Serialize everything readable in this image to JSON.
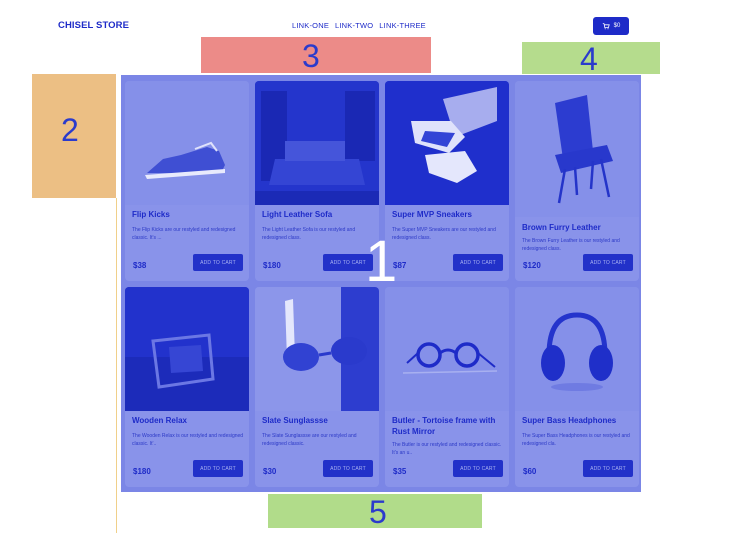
{
  "header": {
    "brand": "CHISEL STORE",
    "nav": [
      "LINK-ONE",
      "LINK-TWO",
      "LINK-THREE"
    ],
    "cart_count": "$0",
    "cart_icon": "cart-icon"
  },
  "annotations": {
    "one": "1",
    "two": "2",
    "three": "3",
    "four": "4",
    "five": "5"
  },
  "products": [
    {
      "title": "Flip Kicks",
      "desc": "The Flip Kicks are our restyled and redesigned classic. It's ...",
      "price": "$38",
      "button": "ADD TO CART"
    },
    {
      "title": "Light Leather Sofa",
      "desc": "The Light Leather Sofa is our restyled and redesigned class.",
      "price": "$180",
      "button": "ADD TO CART"
    },
    {
      "title": "Super MVP Sneakers",
      "desc": "The Super MVP Sneakers are our restyled and redesigned class.",
      "price": "$87",
      "button": "ADD TO CART"
    },
    {
      "title": "Brown Furry Leather",
      "desc": "The Brown Furry Leather is our restyled and redesigned class.",
      "price": "$120",
      "button": "ADD TO CART"
    },
    {
      "title": "Wooden Relax",
      "desc": "The Wooden Relax is our restyled and redesigned classic. It'..",
      "price": "$180",
      "button": "ADD TO CART"
    },
    {
      "title": "Slate Sunglassse",
      "desc": "The Slate Sunglassse are our restyled and redesigned classic.",
      "price": "$30",
      "button": "ADD TO CART"
    },
    {
      "title": "Butler - Tortoise frame with Rust Mirror",
      "desc": "The Butler is our restyled and redesigned classic. It's an u..",
      "price": "$35",
      "button": "ADD TO CART"
    },
    {
      "title": "Super Bass Headphones",
      "desc": "The Super Bass Headphones is our restyled and redesigned cla.",
      "price": "$60",
      "button": "ADD TO CART"
    }
  ],
  "colors": {
    "primary": "#1e2bc8",
    "overlay": "#7b86e6",
    "sidebar": "#ecbf84",
    "banner3": "#ec8b88",
    "banner4": "#b5dc8d",
    "banner5": "#b1dc8a"
  }
}
